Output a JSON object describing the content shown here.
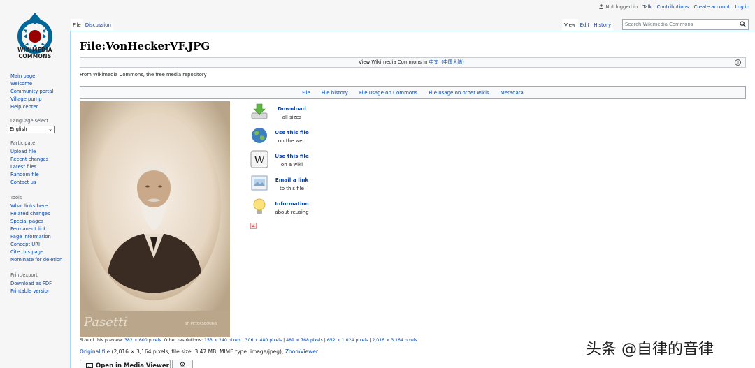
{
  "logo": {
    "line1": "WIKIMEDIA",
    "line2": "COMMONS"
  },
  "sidebar": {
    "nav": [
      "Main page",
      "Welcome",
      "Community portal",
      "Village pump",
      "Help center"
    ],
    "language_heading": "Language select",
    "language_value": "English",
    "participate_heading": "Participate",
    "participate": [
      "Upload file",
      "Recent changes",
      "Latest files",
      "Random file",
      "Contact us"
    ],
    "tools_heading": "Tools",
    "tools": [
      "What links here",
      "Related changes",
      "Special pages",
      "Permanent link",
      "Page information",
      "Concept URI",
      "Cite this page",
      "Nominate for deletion"
    ],
    "print_heading": "Print/export",
    "print": [
      "Download as PDF",
      "Printable version"
    ]
  },
  "personal": {
    "not_logged": "Not logged in",
    "talk": "Talk",
    "contributions": "Contributions",
    "create_account": "Create account",
    "log_in": "Log in"
  },
  "tabs": {
    "file": "File",
    "discussion": "Discussion",
    "view": "View",
    "edit": "Edit",
    "history": "History"
  },
  "search": {
    "placeholder": "Search Wikimedia Commons"
  },
  "page": {
    "title": "File:VonHeckerVF.JPG",
    "uls_prefix": "View Wikimedia Commons in ",
    "uls_lang": "中文（中国大陆）",
    "tagline": "From Wikimedia Commons, the free media repository"
  },
  "filetoc": [
    "File",
    "File history",
    "File usage on Commons",
    "File usage on other wikis",
    "Metadata"
  ],
  "actions": [
    {
      "title": "Download",
      "sub": "all sizes",
      "icon": "download-icon"
    },
    {
      "title": "Use this file",
      "sub": "on the web",
      "icon": "globe-icon"
    },
    {
      "title": "Use this file",
      "sub": "on a wiki",
      "icon": "wikipedia-icon"
    },
    {
      "title": "Email a link",
      "sub": "to this file",
      "icon": "email-icon"
    },
    {
      "title": "Information",
      "sub": "about reusing",
      "icon": "lightbulb-icon"
    }
  ],
  "resolutions": {
    "prefix": "Size of this preview: ",
    "preview": "382 × 600 pixels",
    "other": ". Other resolutions: ",
    "r1": "153 × 240 pixels",
    "r2": "306 × 480 pixels",
    "r3": "489 × 768 pixels",
    "r4": "652 × 1,024 pixels",
    "r5": "2,016 × 3,164 pixels",
    "sep": " | ",
    "end": "."
  },
  "original": {
    "link": "Original file",
    "info": " (2,016 × 3,164 pixels, file size: 3.47 MB, MIME type: image/jpeg); ",
    "zoom": "ZoomViewer"
  },
  "media_viewer": {
    "label": "Open in Media Viewer",
    "gear": "⚙"
  },
  "watermark": "头条 @自律的音律",
  "photo": {
    "signature": "Pasetti",
    "studio": "ST. PETERSBOURG"
  }
}
